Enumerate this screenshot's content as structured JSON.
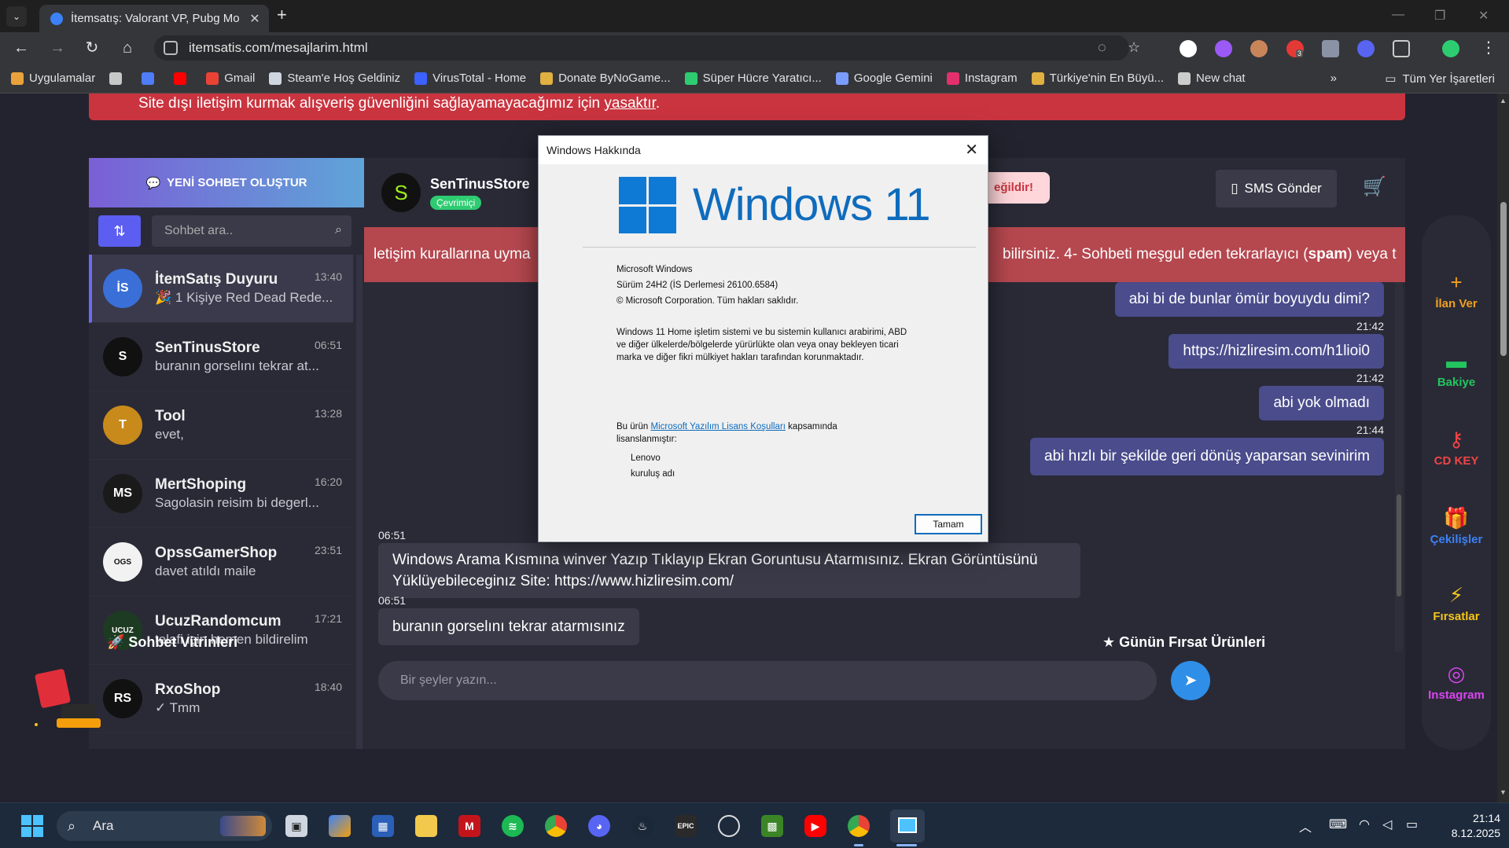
{
  "browser": {
    "tab_title": "İtemsatış: Valorant VP, Pubg Mo",
    "url": "itemsatis.com/mesajlarim.html",
    "bookmarks": [
      {
        "label": "Uygulamalar",
        "icon": "apps-grid-icon",
        "color": "#e9a23b"
      },
      {
        "label": "",
        "icon": "tab-groups-icon",
        "color": "#c8c8c8"
      },
      {
        "label": "",
        "icon": "blue-app-icon",
        "color": "#4f7cf7"
      },
      {
        "label": "",
        "icon": "youtube-icon",
        "color": "#ff0000"
      },
      {
        "label": "Gmail",
        "icon": "gmail-icon",
        "color": "#ea4335"
      },
      {
        "label": "Steam'e Hoş Geldiniz",
        "icon": "steam-icon",
        "color": "#cfd6e0"
      },
      {
        "label": "VirusTotal - Home",
        "icon": "virustotal-icon",
        "color": "#3b61ff"
      },
      {
        "label": "Donate ByNoGame...",
        "icon": "bynogame-icon",
        "color": "#e0b040"
      },
      {
        "label": "Süper Hücre Yaratıcı...",
        "icon": "supercell-icon",
        "color": "#2ecc71"
      },
      {
        "label": "Google Gemini",
        "icon": "gemini-icon",
        "color": "#7b9cff"
      },
      {
        "label": "Instagram",
        "icon": "instagram-icon",
        "color": "#e1306c"
      },
      {
        "label": "Türkiye'nin En Büyü...",
        "icon": "bynogame-icon-2",
        "color": "#e0b040"
      },
      {
        "label": "New chat",
        "icon": "openai-icon",
        "color": "#cccccc"
      }
    ],
    "bookmarks_overflow": "»",
    "all_bookmarks": "Tüm Yer İşaretleri",
    "extension_badge": "3"
  },
  "site": {
    "warning_text": "Site dışı iletişim kurmak alışveriş güvenliğini sağlayamayacağımız için ",
    "warning_link": "yasaktır",
    "new_chat_button": "YENİ SOHBET OLUŞTUR",
    "search_placeholder": "Sohbet ara..",
    "conversations": [
      {
        "name": "İtemSatış Duyuru",
        "time": "13:40",
        "preview": "🎉 1 Kişiye Red Dead Rede...",
        "avatar_color": "#3a6fd8",
        "avatar_text": "İS"
      },
      {
        "name": "SenTinusStore",
        "time": "06:51",
        "preview": "buranın gorselını tekrar at...",
        "avatar_color": "#111111",
        "avatar_text": "S"
      },
      {
        "name": "Tool",
        "time": "13:28",
        "preview": "evet,",
        "avatar_color": "#c88a1a",
        "avatar_text": "T"
      },
      {
        "name": "MertShoping",
        "time": "16:20",
        "preview": "Sagolasin reisim bi degerl...",
        "avatar_color": "#1a1a1a",
        "avatar_text": "MS"
      },
      {
        "name": "OpssGamerShop",
        "time": "23:51",
        "preview": "davet atıldı maile",
        "avatar_color": "#f2f2f2",
        "avatar_text": "OGS"
      },
      {
        "name": "UcuzRandomcum",
        "time": "17:21",
        "preview": "telafi için hemen bildirelim",
        "avatar_color": "#1d3b22",
        "avatar_text": "UCUZ"
      },
      {
        "name": "RxoShop",
        "time": "18:40",
        "preview": "✓ Tmm",
        "avatar_color": "#111111",
        "avatar_text": "RS"
      }
    ],
    "chat": {
      "contact_name": "SenTinusStore",
      "status": "Çevrimiçi",
      "red_pill": "eğildir!",
      "sms_button": "SMS Gönder",
      "rules_left": "letişim kurallarına uyma",
      "rules_right_a": "bilirsiniz. 4- Sohbeti meşgul eden tekrarlayıcı (",
      "rules_right_b": "spam",
      "rules_right_c": ") veya t",
      "outgoing": [
        {
          "text": "abi bi de bunlar ömür boyuydu dimi?",
          "time": "21:42"
        },
        {
          "text": "https://hizliresim.com/h1lioi0",
          "time": "21:42"
        },
        {
          "text": "abi yok olmadı",
          "time": "21:44"
        },
        {
          "text": "abi hızlı bir şekilde geri dönüş yaparsan sevinirim",
          "time": ""
        }
      ],
      "incoming": [
        {
          "time": "06:51",
          "line1": "Windows Arama Kısmına winver Yazıp Tıklayıp Ekran Goruntusu Atarmısınız. Ekran Görüntüsünü",
          "line2": "Yüklüyebileceginız Site: https://www.hizliresim.com/"
        },
        {
          "time": "06:51",
          "line1": "buranın gorselını tekrar atarmısınız",
          "line2": ""
        }
      ],
      "input_placeholder": "Bir şeyler yazın..."
    },
    "right_menu": [
      {
        "label": "İlan Ver",
        "glyph": "+",
        "color": "#f0a020"
      },
      {
        "label": "Bakiye",
        "glyph": "▬",
        "color": "#22c55e"
      },
      {
        "label": "CD KEY",
        "glyph": "⚷",
        "color": "#ef4444"
      },
      {
        "label": "Çekilişler",
        "glyph": "🎁",
        "color": "#3b82f6"
      },
      {
        "label": "Fırsatlar",
        "glyph": "⚡",
        "color": "#f5c518"
      },
      {
        "label": "Instagram",
        "glyph": "◎",
        "color": "#d946ef"
      }
    ],
    "section_left": "Sohbet Vitrinleri",
    "section_right": "Günün Fırsat Ürünleri"
  },
  "dialog": {
    "title": "Windows Hakkında",
    "logo_text": "Windows 11",
    "product": "Microsoft Windows",
    "version": "Sürüm 24H2 (İS Derlemesi 26100.6584)",
    "copyright": "© Microsoft Corporation. Tüm hakları saklıdır.",
    "para1": "Windows 11 Home işletim sistemi ve bu sistemin kullanıcı arabirimi, ABD",
    "para2": "ve diğer ülkelerde/bölgelerde yürürlükte olan veya onay bekleyen ticari",
    "para3": "marka ve diğer fikri mülkiyet hakları tarafından korunmaktadır.",
    "license_pre": "Bu ürün ",
    "license_link": "Microsoft Yazılım Lisans Koşulları",
    "license_post": " kapsamında",
    "license_line2": "lisanslanmıştır:",
    "licensee1": "Lenovo",
    "licensee2": "kuruluş adı",
    "ok_button": "Tamam"
  },
  "taskbar": {
    "search_label": "Ara",
    "time": "21:14",
    "date": "8.12.2025"
  }
}
